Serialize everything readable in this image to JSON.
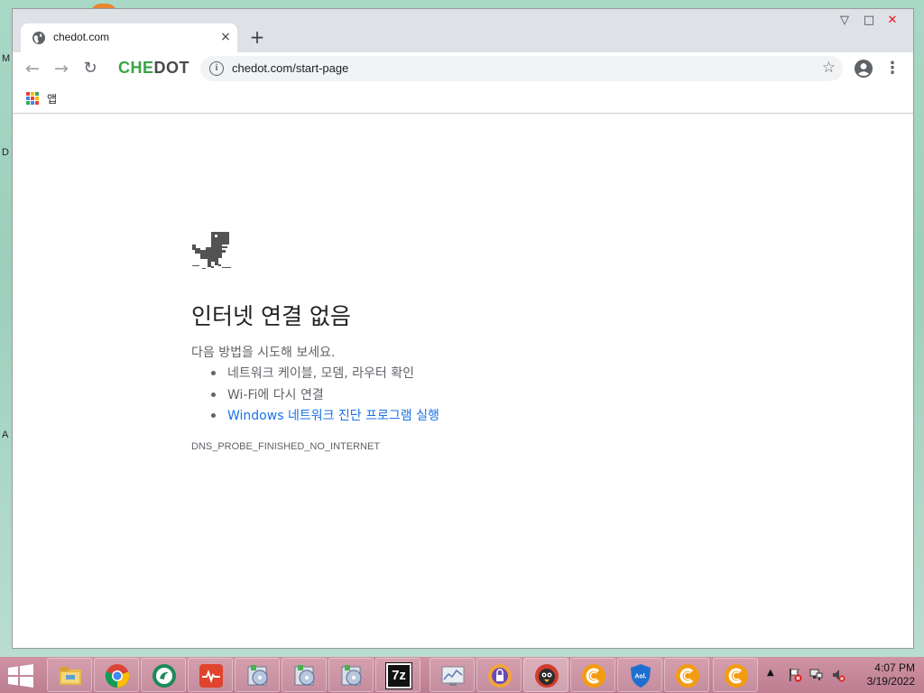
{
  "desktop": {
    "side_letters": [
      "M",
      "D",
      "A"
    ]
  },
  "browser": {
    "tab": {
      "title": "chedot.com",
      "close": "×"
    },
    "new_tab": "+",
    "window_controls": {
      "minimize": "▽",
      "maximize": "□",
      "close": "✕"
    },
    "nav": {
      "back": "←",
      "forward": "→",
      "reload": "↻"
    },
    "brand": {
      "che": "CHE",
      "dot": "DOT"
    },
    "omnibox": {
      "info": "i",
      "url": "chedot.com/start-page",
      "star": "☆"
    },
    "menu": "⋮",
    "bookmarks": {
      "apps_label": "앱"
    }
  },
  "error_page": {
    "heading": "인터넷 연결 없음",
    "suggestion_intro": "다음 방법을 시도해 보세요.",
    "suggestions": [
      {
        "text": "네트워크 케이블, 모뎀, 라우터 확인"
      },
      {
        "text": "Wi-Fi에 다시 연결"
      },
      {
        "text": "Windows 네트워크 진단 프로그램 실행"
      }
    ],
    "error_code": "DNS_PROBE_FINISHED_NO_INTERNET"
  },
  "taskbar": {
    "items": [
      "file-explorer",
      "chrome",
      "browser-green",
      "health-app",
      "installer",
      "installer",
      "installer",
      "7zip",
      "network-monitor",
      "vpn-app",
      "bird-app",
      "chedot",
      "aol-shield",
      "chedot",
      "chedot"
    ],
    "sevenzip_label": "7z",
    "aol_label": "Aol.",
    "tray_arrow": "▲",
    "time": "4:07 PM",
    "date": "3/19/2022"
  },
  "colors": {
    "brand_green": "#37a447",
    "link_blue": "#1a73e8",
    "tab_strip": "#dee1e6",
    "taskbar": "#c5879a"
  }
}
